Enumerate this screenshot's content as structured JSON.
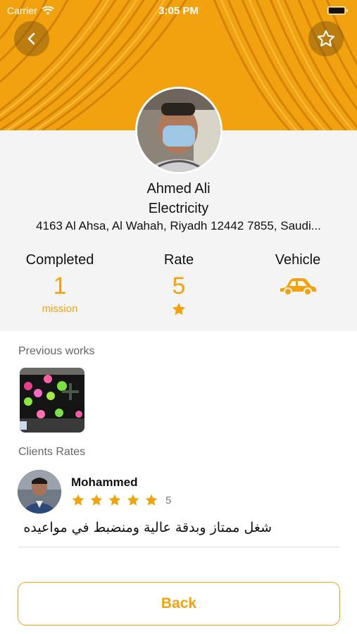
{
  "colors": {
    "accent": "#f2a20e"
  },
  "status_bar": {
    "carrier": "Carrier",
    "time": "3:05 PM"
  },
  "header": {
    "back_icon": "chevron-left-icon",
    "favorite_icon": "star-outline-icon"
  },
  "profile": {
    "name": "Ahmed Ali",
    "category": "Electricity",
    "address": "4163 Al Ahsa, Al Wahah, Riyadh 12442 7855, Saudi..."
  },
  "stats": {
    "completed": {
      "title": "Completed",
      "value": "1",
      "unit": "mission"
    },
    "rate": {
      "title": "Rate",
      "value": "5",
      "icon": "star-icon"
    },
    "vehicle": {
      "title": "Vehicle",
      "icon": "car-icon"
    }
  },
  "previous_works": {
    "label": "Previous works"
  },
  "client_rates": {
    "label": "Clients Rates",
    "reviews": [
      {
        "name": "Mohammed",
        "stars": 5,
        "rating_text": "5",
        "comment": "شغل ممتاز وبدقة عالية ومنضبط في مواعيده"
      }
    ]
  },
  "footer": {
    "back_label": "Back"
  }
}
